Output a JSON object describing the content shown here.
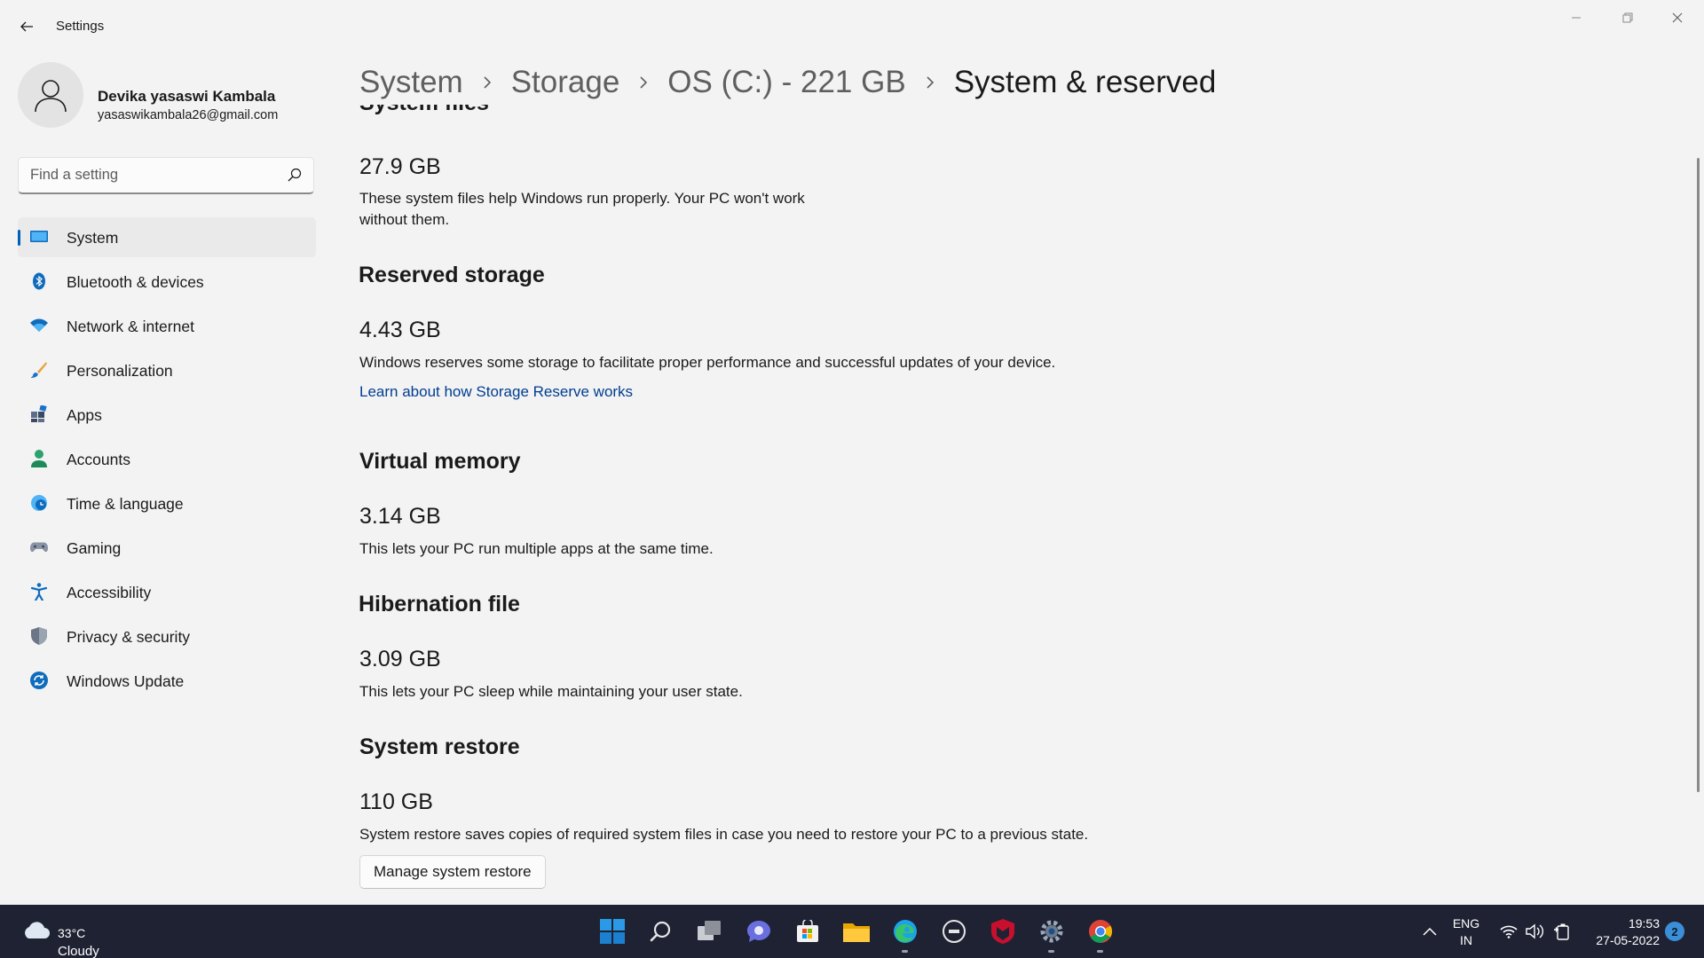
{
  "window": {
    "title": "Settings",
    "back_icon": "back-arrow-icon",
    "controls": [
      "minimize-icon",
      "restore-icon",
      "close-icon"
    ]
  },
  "profile": {
    "name": "Devika yasaswi Kambala",
    "email": "yasaswikambala26@gmail.com"
  },
  "search": {
    "placeholder": "Find a setting",
    "value": ""
  },
  "sidebar": {
    "items": [
      {
        "label": "System",
        "icon": "monitor-icon",
        "active": true
      },
      {
        "label": "Bluetooth & devices",
        "icon": "bluetooth-icon"
      },
      {
        "label": "Network & internet",
        "icon": "wifi-icon"
      },
      {
        "label": "Personalization",
        "icon": "brush-icon"
      },
      {
        "label": "Apps",
        "icon": "apps-icon"
      },
      {
        "label": "Accounts",
        "icon": "person-icon"
      },
      {
        "label": "Time & language",
        "icon": "globe-clock-icon"
      },
      {
        "label": "Gaming",
        "icon": "gamepad-icon"
      },
      {
        "label": "Accessibility",
        "icon": "accessibility-icon"
      },
      {
        "label": "Privacy & security",
        "icon": "shield-icon"
      },
      {
        "label": "Windows Update",
        "icon": "update-icon"
      }
    ]
  },
  "breadcrumb": {
    "items": [
      "System",
      "Storage",
      "OS (C:) - 221 GB"
    ],
    "current": "System & reserved"
  },
  "sections": {
    "system_files": {
      "title": "System files",
      "size": "27.9 GB",
      "desc_line1": "These system files help Windows run properly. Your PC won't work",
      "desc_line2": "without them."
    },
    "reserved": {
      "title": "Reserved storage",
      "size": "4.43 GB",
      "desc": "Windows reserves some storage to facilitate proper performance and successful updates of your device.",
      "link": "Learn about how Storage Reserve works"
    },
    "virtual_memory": {
      "title": "Virtual memory",
      "size": "3.14 GB",
      "desc": "This lets your PC run multiple apps at the same time."
    },
    "hibernation": {
      "title": "Hibernation file",
      "size": "3.09 GB",
      "desc": "This lets your PC sleep while maintaining your user state."
    },
    "system_restore": {
      "title": "System restore",
      "size": "110 GB",
      "desc": "System restore saves copies of required system files in case you need to restore your PC to a previous state.",
      "button": "Manage system restore"
    }
  },
  "taskbar": {
    "weather": {
      "temp": "33°C",
      "condition": "Cloudy",
      "icon": "cloud-icon"
    },
    "apps": [
      "windows-start-icon",
      "search-icon",
      "task-view-icon",
      "teams-chat-icon",
      "microsoft-store-icon",
      "file-explorer-icon",
      "edge-browser-icon",
      "dell-icon",
      "mcafee-icon",
      "settings-gear-icon",
      "chrome-browser-icon"
    ],
    "tray": [
      "chevron-up-icon",
      "wifi-icon",
      "volume-icon",
      "battery-icon"
    ],
    "language": {
      "line1": "ENG",
      "line2": "IN"
    },
    "clock": {
      "time": "19:53",
      "date": "27-05-2022"
    },
    "notifications": "2"
  },
  "colors": {
    "accent": "#005fb8",
    "link": "#003e92",
    "background": "#f3f3f3",
    "taskbar": "#1f2233"
  }
}
